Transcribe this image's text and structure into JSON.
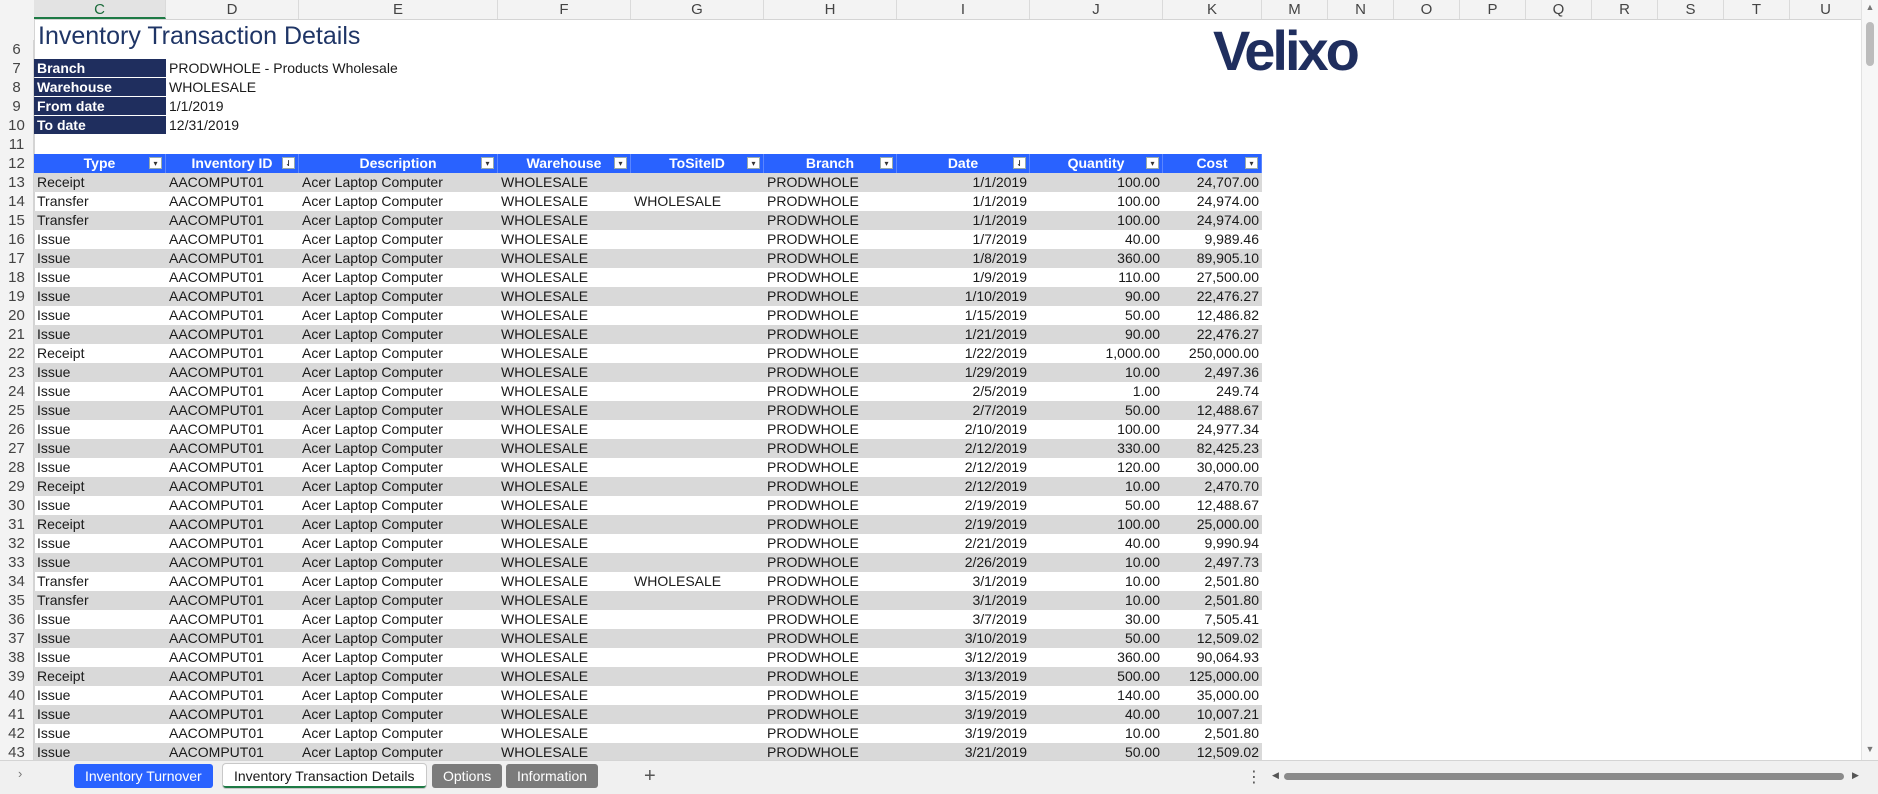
{
  "columns": [
    {
      "letter": "C",
      "selected": true
    },
    {
      "letter": "D"
    },
    {
      "letter": "E"
    },
    {
      "letter": "F"
    },
    {
      "letter": "G"
    },
    {
      "letter": "H"
    },
    {
      "letter": "I"
    },
    {
      "letter": "J"
    },
    {
      "letter": "K"
    },
    {
      "letter": "M"
    },
    {
      "letter": "N"
    },
    {
      "letter": "O"
    },
    {
      "letter": "P"
    },
    {
      "letter": "Q"
    },
    {
      "letter": "R"
    },
    {
      "letter": "S"
    },
    {
      "letter": "T"
    },
    {
      "letter": "U"
    }
  ],
  "report": {
    "title": "Inventory Transaction Details",
    "logo_text": "Velixo",
    "params": [
      {
        "row": "7",
        "label": "Branch",
        "value": "PRODWHOLE - Products Wholesale"
      },
      {
        "row": "8",
        "label": "Warehouse",
        "value": "WHOLESALE"
      },
      {
        "row": "9",
        "label": "From date",
        "value": "1/1/2019"
      },
      {
        "row": "10",
        "label": "To date",
        "value": "12/31/2019"
      }
    ],
    "pre_rows": [
      "6",
      "7",
      "8",
      "9",
      "10",
      "11",
      "12"
    ]
  },
  "table": {
    "headers": [
      {
        "label": "Type",
        "filter": "▾"
      },
      {
        "label": "Inventory ID",
        "filter": "⇃"
      },
      {
        "label": "Description",
        "filter": "▾"
      },
      {
        "label": "Warehouse",
        "filter": "▾"
      },
      {
        "label": "ToSiteID",
        "filter": "▾"
      },
      {
        "label": "Branch",
        "filter": "▾"
      },
      {
        "label": "Date",
        "filter": "⇃"
      },
      {
        "label": "Quantity",
        "filter": "▾"
      },
      {
        "label": "Cost",
        "filter": "▾"
      }
    ],
    "rows": [
      {
        "n": "13",
        "type": "Receipt",
        "id": "AACOMPUT01",
        "desc": "Acer Laptop Computer",
        "wh": "WHOLESALE",
        "to": "",
        "br": "PRODWHOLE",
        "date": "1/1/2019",
        "qty": "100.00",
        "cost": "24,707.00"
      },
      {
        "n": "14",
        "type": "Transfer",
        "id": "AACOMPUT01",
        "desc": "Acer Laptop Computer",
        "wh": "WHOLESALE",
        "to": "WHOLESALE",
        "br": "PRODWHOLE",
        "date": "1/1/2019",
        "qty": "100.00",
        "cost": "24,974.00"
      },
      {
        "n": "15",
        "type": "Transfer",
        "id": "AACOMPUT01",
        "desc": "Acer Laptop Computer",
        "wh": "WHOLESALE",
        "to": "",
        "br": "PRODWHOLE",
        "date": "1/1/2019",
        "qty": "100.00",
        "cost": "24,974.00"
      },
      {
        "n": "16",
        "type": "Issue",
        "id": "AACOMPUT01",
        "desc": "Acer Laptop Computer",
        "wh": "WHOLESALE",
        "to": "",
        "br": "PRODWHOLE",
        "date": "1/7/2019",
        "qty": "40.00",
        "cost": "9,989.46"
      },
      {
        "n": "17",
        "type": "Issue",
        "id": "AACOMPUT01",
        "desc": "Acer Laptop Computer",
        "wh": "WHOLESALE",
        "to": "",
        "br": "PRODWHOLE",
        "date": "1/8/2019",
        "qty": "360.00",
        "cost": "89,905.10"
      },
      {
        "n": "18",
        "type": "Issue",
        "id": "AACOMPUT01",
        "desc": "Acer Laptop Computer",
        "wh": "WHOLESALE",
        "to": "",
        "br": "PRODWHOLE",
        "date": "1/9/2019",
        "qty": "110.00",
        "cost": "27,500.00"
      },
      {
        "n": "19",
        "type": "Issue",
        "id": "AACOMPUT01",
        "desc": "Acer Laptop Computer",
        "wh": "WHOLESALE",
        "to": "",
        "br": "PRODWHOLE",
        "date": "1/10/2019",
        "qty": "90.00",
        "cost": "22,476.27"
      },
      {
        "n": "20",
        "type": "Issue",
        "id": "AACOMPUT01",
        "desc": "Acer Laptop Computer",
        "wh": "WHOLESALE",
        "to": "",
        "br": "PRODWHOLE",
        "date": "1/15/2019",
        "qty": "50.00",
        "cost": "12,486.82"
      },
      {
        "n": "21",
        "type": "Issue",
        "id": "AACOMPUT01",
        "desc": "Acer Laptop Computer",
        "wh": "WHOLESALE",
        "to": "",
        "br": "PRODWHOLE",
        "date": "1/21/2019",
        "qty": "90.00",
        "cost": "22,476.27"
      },
      {
        "n": "22",
        "type": "Receipt",
        "id": "AACOMPUT01",
        "desc": "Acer Laptop Computer",
        "wh": "WHOLESALE",
        "to": "",
        "br": "PRODWHOLE",
        "date": "1/22/2019",
        "qty": "1,000.00",
        "cost": "250,000.00"
      },
      {
        "n": "23",
        "type": "Issue",
        "id": "AACOMPUT01",
        "desc": "Acer Laptop Computer",
        "wh": "WHOLESALE",
        "to": "",
        "br": "PRODWHOLE",
        "date": "1/29/2019",
        "qty": "10.00",
        "cost": "2,497.36"
      },
      {
        "n": "24",
        "type": "Issue",
        "id": "AACOMPUT01",
        "desc": "Acer Laptop Computer",
        "wh": "WHOLESALE",
        "to": "",
        "br": "PRODWHOLE",
        "date": "2/5/2019",
        "qty": "1.00",
        "cost": "249.74"
      },
      {
        "n": "25",
        "type": "Issue",
        "id": "AACOMPUT01",
        "desc": "Acer Laptop Computer",
        "wh": "WHOLESALE",
        "to": "",
        "br": "PRODWHOLE",
        "date": "2/7/2019",
        "qty": "50.00",
        "cost": "12,488.67"
      },
      {
        "n": "26",
        "type": "Issue",
        "id": "AACOMPUT01",
        "desc": "Acer Laptop Computer",
        "wh": "WHOLESALE",
        "to": "",
        "br": "PRODWHOLE",
        "date": "2/10/2019",
        "qty": "100.00",
        "cost": "24,977.34"
      },
      {
        "n": "27",
        "type": "Issue",
        "id": "AACOMPUT01",
        "desc": "Acer Laptop Computer",
        "wh": "WHOLESALE",
        "to": "",
        "br": "PRODWHOLE",
        "date": "2/12/2019",
        "qty": "330.00",
        "cost": "82,425.23"
      },
      {
        "n": "28",
        "type": "Issue",
        "id": "AACOMPUT01",
        "desc": "Acer Laptop Computer",
        "wh": "WHOLESALE",
        "to": "",
        "br": "PRODWHOLE",
        "date": "2/12/2019",
        "qty": "120.00",
        "cost": "30,000.00"
      },
      {
        "n": "29",
        "type": "Receipt",
        "id": "AACOMPUT01",
        "desc": "Acer Laptop Computer",
        "wh": "WHOLESALE",
        "to": "",
        "br": "PRODWHOLE",
        "date": "2/12/2019",
        "qty": "10.00",
        "cost": "2,470.70"
      },
      {
        "n": "30",
        "type": "Issue",
        "id": "AACOMPUT01",
        "desc": "Acer Laptop Computer",
        "wh": "WHOLESALE",
        "to": "",
        "br": "PRODWHOLE",
        "date": "2/19/2019",
        "qty": "50.00",
        "cost": "12,488.67"
      },
      {
        "n": "31",
        "type": "Receipt",
        "id": "AACOMPUT01",
        "desc": "Acer Laptop Computer",
        "wh": "WHOLESALE",
        "to": "",
        "br": "PRODWHOLE",
        "date": "2/19/2019",
        "qty": "100.00",
        "cost": "25,000.00"
      },
      {
        "n": "32",
        "type": "Issue",
        "id": "AACOMPUT01",
        "desc": "Acer Laptop Computer",
        "wh": "WHOLESALE",
        "to": "",
        "br": "PRODWHOLE",
        "date": "2/21/2019",
        "qty": "40.00",
        "cost": "9,990.94"
      },
      {
        "n": "33",
        "type": "Issue",
        "id": "AACOMPUT01",
        "desc": "Acer Laptop Computer",
        "wh": "WHOLESALE",
        "to": "",
        "br": "PRODWHOLE",
        "date": "2/26/2019",
        "qty": "10.00",
        "cost": "2,497.73"
      },
      {
        "n": "34",
        "type": "Transfer",
        "id": "AACOMPUT01",
        "desc": "Acer Laptop Computer",
        "wh": "WHOLESALE",
        "to": "WHOLESALE",
        "br": "PRODWHOLE",
        "date": "3/1/2019",
        "qty": "10.00",
        "cost": "2,501.80"
      },
      {
        "n": "35",
        "type": "Transfer",
        "id": "AACOMPUT01",
        "desc": "Acer Laptop Computer",
        "wh": "WHOLESALE",
        "to": "",
        "br": "PRODWHOLE",
        "date": "3/1/2019",
        "qty": "10.00",
        "cost": "2,501.80"
      },
      {
        "n": "36",
        "type": "Issue",
        "id": "AACOMPUT01",
        "desc": "Acer Laptop Computer",
        "wh": "WHOLESALE",
        "to": "",
        "br": "PRODWHOLE",
        "date": "3/7/2019",
        "qty": "30.00",
        "cost": "7,505.41"
      },
      {
        "n": "37",
        "type": "Issue",
        "id": "AACOMPUT01",
        "desc": "Acer Laptop Computer",
        "wh": "WHOLESALE",
        "to": "",
        "br": "PRODWHOLE",
        "date": "3/10/2019",
        "qty": "50.00",
        "cost": "12,509.02"
      },
      {
        "n": "38",
        "type": "Issue",
        "id": "AACOMPUT01",
        "desc": "Acer Laptop Computer",
        "wh": "WHOLESALE",
        "to": "",
        "br": "PRODWHOLE",
        "date": "3/12/2019",
        "qty": "360.00",
        "cost": "90,064.93"
      },
      {
        "n": "39",
        "type": "Receipt",
        "id": "AACOMPUT01",
        "desc": "Acer Laptop Computer",
        "wh": "WHOLESALE",
        "to": "",
        "br": "PRODWHOLE",
        "date": "3/13/2019",
        "qty": "500.00",
        "cost": "125,000.00"
      },
      {
        "n": "40",
        "type": "Issue",
        "id": "AACOMPUT01",
        "desc": "Acer Laptop Computer",
        "wh": "WHOLESALE",
        "to": "",
        "br": "PRODWHOLE",
        "date": "3/15/2019",
        "qty": "140.00",
        "cost": "35,000.00"
      },
      {
        "n": "41",
        "type": "Issue",
        "id": "AACOMPUT01",
        "desc": "Acer Laptop Computer",
        "wh": "WHOLESALE",
        "to": "",
        "br": "PRODWHOLE",
        "date": "3/19/2019",
        "qty": "40.00",
        "cost": "10,007.21"
      },
      {
        "n": "42",
        "type": "Issue",
        "id": "AACOMPUT01",
        "desc": "Acer Laptop Computer",
        "wh": "WHOLESALE",
        "to": "",
        "br": "PRODWHOLE",
        "date": "3/19/2019",
        "qty": "10.00",
        "cost": "2,501.80"
      },
      {
        "n": "43",
        "type": "Issue",
        "id": "AACOMPUT01",
        "desc": "Acer Laptop Computer",
        "wh": "WHOLESALE",
        "to": "",
        "br": "PRODWHOLE",
        "date": "3/21/2019",
        "qty": "50.00",
        "cost": "12,509.02"
      }
    ]
  },
  "tabs": [
    {
      "label": "Inventory Turnover",
      "style": "blue"
    },
    {
      "label": "Inventory Transaction Details",
      "style": "active"
    },
    {
      "label": "Options",
      "style": "gray"
    },
    {
      "label": "Information",
      "style": "gray"
    }
  ],
  "tabbar": {
    "add_label": "+",
    "more_label": "⋮",
    "nav_label": "›"
  },
  "colors": {
    "header_blue": "#2962ff",
    "param_navy": "#1f2e5e",
    "alt_row": "#d9d9d9"
  }
}
